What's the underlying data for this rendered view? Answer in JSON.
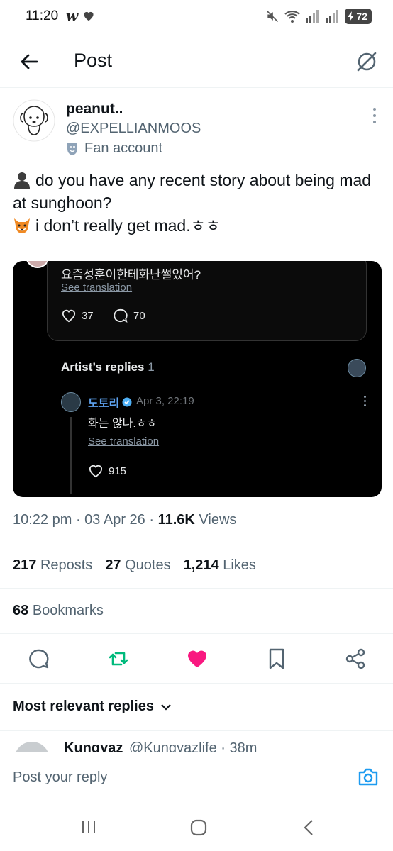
{
  "status_bar": {
    "time": "11:20",
    "app_glyph": "w",
    "battery": "72"
  },
  "header": {
    "title": "Post"
  },
  "author": {
    "name": "peanut..",
    "handle": "@EXPELLIANMOOS",
    "badge": "Fan account"
  },
  "post": {
    "line1": "do you have any recent story about being mad at sunghoon?",
    "line2": "i don’t really get mad.ㅎㅎ"
  },
  "embed": {
    "question": "요즘성훈이한테화난썰있어?",
    "question_translate": "See translation",
    "question_likes": "37",
    "question_comments": "70",
    "artist_replies_label": "Artist’s replies",
    "artist_replies_count": "1",
    "reply_name": "도토리",
    "reply_date": "Apr 3, 22:19",
    "reply_text": "화는 않나.ㅎㅎ",
    "reply_translate": "See translation",
    "reply_likes": "915"
  },
  "meta": {
    "time": "10:22 pm",
    "date": "03 Apr 26",
    "views_count": "11.6K",
    "views_label": "Views"
  },
  "stats": {
    "reposts_count": "217",
    "reposts_label": "Reposts",
    "quotes_count": "27",
    "quotes_label": "Quotes",
    "likes_count": "1,214",
    "likes_label": "Likes",
    "bookmarks_count": "68",
    "bookmarks_label": "Bookmarks"
  },
  "replies_sort": "Most relevant replies",
  "next_reply": {
    "name": "Kungyaz",
    "handle": "@Kungyazlife · 38m"
  },
  "composer": {
    "placeholder": "Post your reply"
  },
  "colors": {
    "like": "#f91880",
    "repost": "#00ba7c",
    "accent": "#1d9bf0"
  }
}
